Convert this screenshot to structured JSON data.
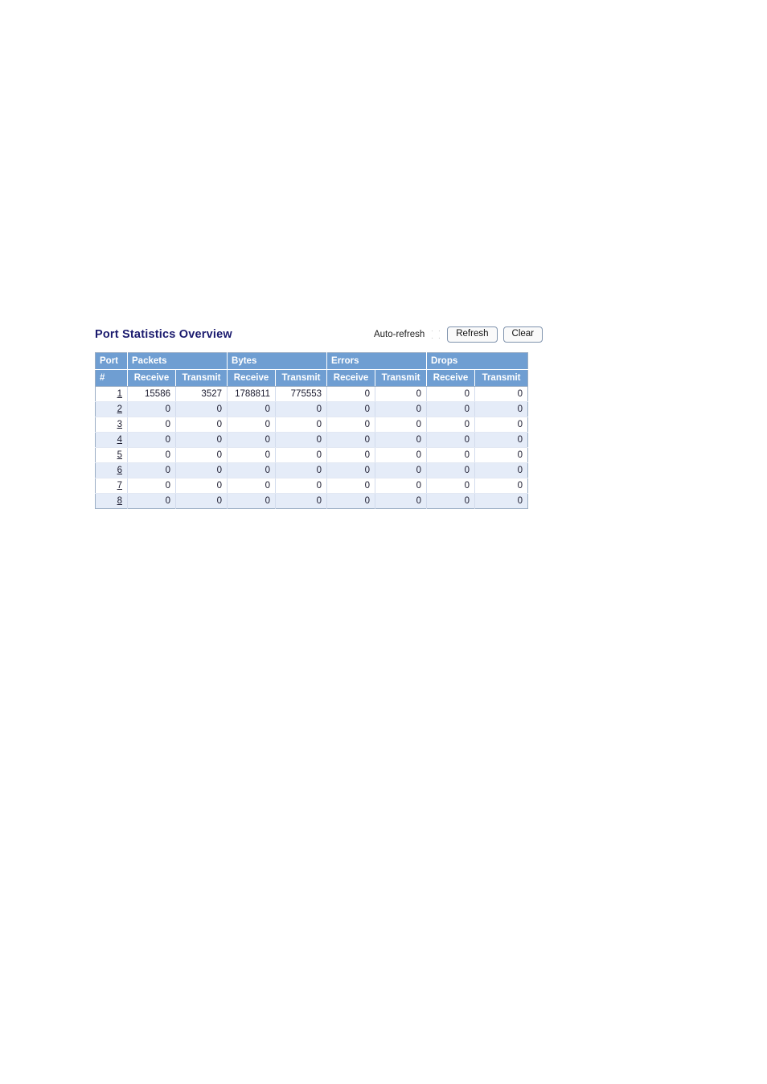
{
  "page": {
    "title": "Port Statistics Overview"
  },
  "controls": {
    "autorefresh_label": "Auto-refresh",
    "autorefresh_checked": false,
    "refresh_label": "Refresh",
    "clear_label": "Clear"
  },
  "colors": {
    "header_blue": "#6f9ed2",
    "title_navy": "#1a1a6e",
    "row_stripe": "#e5ecf8",
    "table_border": "#9aadc4"
  },
  "table": {
    "group_headers": [
      {
        "label": "Port",
        "span": 1
      },
      {
        "label": "Packets",
        "span": 2
      },
      {
        "label": "Bytes",
        "span": 2
      },
      {
        "label": "Errors",
        "span": 2
      },
      {
        "label": "Drops",
        "span": 2
      }
    ],
    "sub_headers": [
      "#",
      "Receive",
      "Transmit",
      "Receive",
      "Transmit",
      "Receive",
      "Transmit",
      "Receive",
      "Transmit"
    ],
    "rows": [
      {
        "port": "1",
        "values": [
          "15586",
          "3527",
          "1788811",
          "775553",
          "0",
          "0",
          "0",
          "0"
        ]
      },
      {
        "port": "2",
        "values": [
          "0",
          "0",
          "0",
          "0",
          "0",
          "0",
          "0",
          "0"
        ]
      },
      {
        "port": "3",
        "values": [
          "0",
          "0",
          "0",
          "0",
          "0",
          "0",
          "0",
          "0"
        ]
      },
      {
        "port": "4",
        "values": [
          "0",
          "0",
          "0",
          "0",
          "0",
          "0",
          "0",
          "0"
        ]
      },
      {
        "port": "5",
        "values": [
          "0",
          "0",
          "0",
          "0",
          "0",
          "0",
          "0",
          "0"
        ]
      },
      {
        "port": "6",
        "values": [
          "0",
          "0",
          "0",
          "0",
          "0",
          "0",
          "0",
          "0"
        ]
      },
      {
        "port": "7",
        "values": [
          "0",
          "0",
          "0",
          "0",
          "0",
          "0",
          "0",
          "0"
        ]
      },
      {
        "port": "8",
        "values": [
          "0",
          "0",
          "0",
          "0",
          "0",
          "0",
          "0",
          "0"
        ]
      }
    ]
  }
}
